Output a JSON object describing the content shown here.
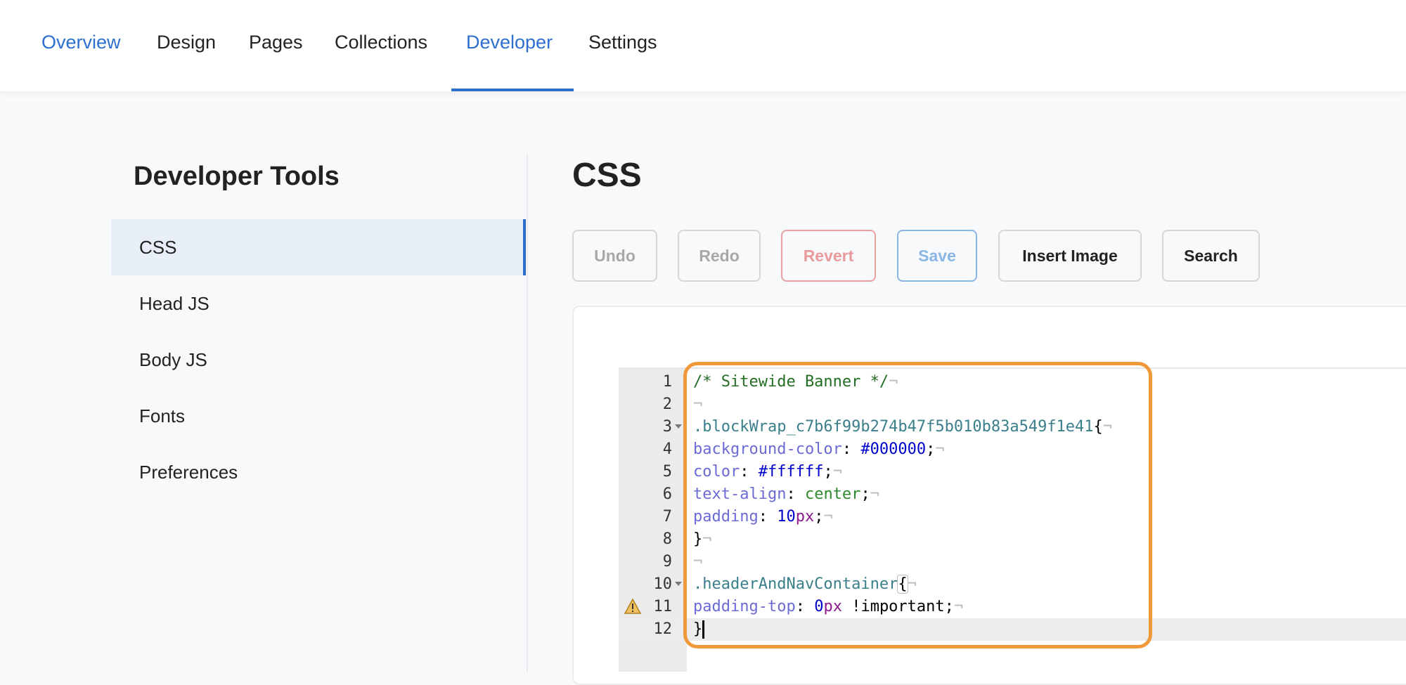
{
  "nav": {
    "tabs": [
      "Overview",
      "Design",
      "Pages",
      "Collections",
      "Developer",
      "Settings"
    ],
    "active": "Developer"
  },
  "sidebar": {
    "title": "Developer Tools",
    "items": [
      "CSS",
      "Head JS",
      "Body JS",
      "Fonts",
      "Preferences"
    ],
    "active": "CSS"
  },
  "main": {
    "title": "CSS",
    "buttons": {
      "undo": "Undo",
      "redo": "Redo",
      "revert": "Revert",
      "save": "Save",
      "insert_image": "Insert Image",
      "search": "Search"
    }
  },
  "editor": {
    "line_numbers": [
      "1",
      "2",
      "3",
      "4",
      "5",
      "6",
      "7",
      "8",
      "9",
      "10",
      "11",
      "12"
    ],
    "lines": {
      "l1": "/* Sitewide Banner */",
      "l3": ".blockWrap_c7b6f99b274b47f5b010b83a549f1e41",
      "l4_prop": "background-color",
      "l4_val": "#000000",
      "l5_prop": "color",
      "l5_val": "#ffffff",
      "l6_prop": "text-align",
      "l6_val": "center",
      "l7_prop": "padding",
      "l7_num": "10",
      "l7_unit": "px",
      "l10": ".headerAndNavContainer",
      "l11_prop": "padding-top",
      "l11_num": "0",
      "l11_unit": "px",
      "l11_imp": "!important"
    },
    "punct": {
      "open": "{",
      "close": "}",
      "colon": ": ",
      "semi": ";",
      "eol": "¬"
    },
    "current_line": "12",
    "warning_line": "11"
  },
  "colors": {
    "accent": "#2d6fcf",
    "highlight": "#f0993a"
  }
}
